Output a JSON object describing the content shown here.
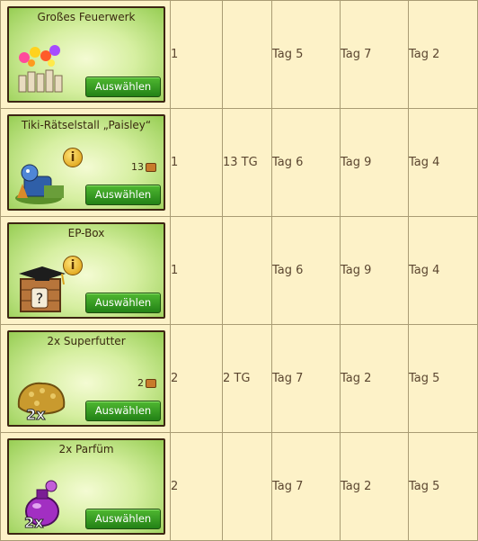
{
  "rows": [
    {
      "name": "Großes Feuerwerk",
      "button": "Auswählen",
      "price": "",
      "qty": "1",
      "tg": "",
      "d1": "Tag 5",
      "d2": "Tag 7",
      "d3": "Tag 2",
      "icon": "fireworks-icon"
    },
    {
      "name": "Tiki-Rätselstall „Paisley“",
      "button": "Auswählen",
      "price": "13",
      "qty": "1",
      "tg": "13 TG",
      "d1": "Tag 6",
      "d2": "Tag 9",
      "d3": "Tag 4",
      "icon": "tiki-stable-icon"
    },
    {
      "name": "EP-Box",
      "button": "Auswählen",
      "price": "",
      "qty": "1",
      "tg": "",
      "d1": "Tag 6",
      "d2": "Tag 9",
      "d3": "Tag 4",
      "icon": "ep-box-icon"
    },
    {
      "name": "2x Superfutter",
      "button": "Auswählen",
      "price": "2",
      "qty": "2",
      "tg": "2 TG",
      "d1": "Tag 7",
      "d2": "Tag 2",
      "d3": "Tag 5",
      "icon": "superfood-icon"
    },
    {
      "name": "2x Parfüm",
      "button": "Auswählen",
      "price": "",
      "qty": "2",
      "tg": "",
      "d1": "Tag 7",
      "d2": "Tag 2",
      "d3": "Tag 5",
      "icon": "perfume-icon"
    }
  ],
  "info_label": "i",
  "badge_2x": "2x",
  "box_question": "?"
}
